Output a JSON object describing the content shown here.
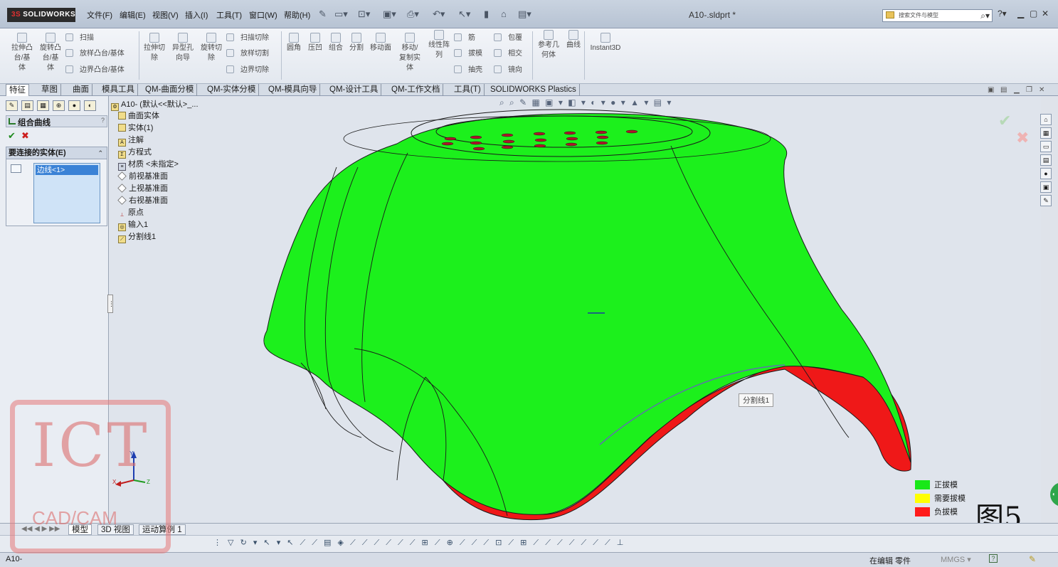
{
  "titlebar": {
    "logo": "SOLIDWORKS",
    "menus": [
      "文件(F)",
      "编辑(E)",
      "视图(V)",
      "插入(I)",
      "工具(T)",
      "窗口(W)",
      "帮助(H)"
    ],
    "document_title": "A10-.sldprt *",
    "search_placeholder": "搜索文件与模型"
  },
  "ribbon": {
    "big_buttons": [
      {
        "label": "拉伸凸\n台/基\n体"
      },
      {
        "label": "旋转凸\n台/基\n体"
      },
      {
        "label": "拉伸切\n除"
      },
      {
        "label": "异型孔\n向导"
      },
      {
        "label": "旋转切\n除"
      },
      {
        "label": "圆角"
      },
      {
        "label": "压凹"
      },
      {
        "label": "组合"
      },
      {
        "label": "分割"
      },
      {
        "label": "移动面"
      },
      {
        "label": "移动/\n复制实\n体"
      },
      {
        "label": "线性阵\n列"
      },
      {
        "label": "参考几\n何体"
      },
      {
        "label": "曲线"
      },
      {
        "label": "Instant3D"
      }
    ],
    "small_buttons": [
      "扫描",
      "放样凸台/基体",
      "边界凸台/基体",
      "扫描切除",
      "放样切割",
      "边界切除",
      "筋",
      "拔模",
      "抽壳",
      "包覆",
      "相交",
      "镜向"
    ]
  },
  "tabs": [
    "特征",
    "草图",
    "曲面",
    "模具工具",
    "QM-曲面分模",
    "QM-实体分模",
    "QM-模具向导",
    "QM-设计工具",
    "QM-工作文档",
    "工具(T)",
    "SOLIDWORKS Plastics"
  ],
  "property_manager": {
    "title": "组合曲线",
    "help": "?",
    "group_title": "要连接的实体(E)",
    "selection": "边线<1>"
  },
  "feature_tree": {
    "root": "A10-  (默认<<默认>_...",
    "items": [
      "曲面实体",
      "实体(1)",
      "注解",
      "方程式",
      "材质 <未指定>",
      "前视基准面",
      "上视基准面",
      "右视基准面",
      "原点",
      "输入1",
      "分割线1"
    ]
  },
  "graphics": {
    "callout": "分割线1",
    "legend": [
      {
        "label": "正拔模",
        "color": "#18e818"
      },
      {
        "label": "需要拔模",
        "color": "#ffff00"
      },
      {
        "label": "负拔模",
        "color": "#ff1a1a"
      }
    ],
    "figure_label": "图5",
    "model_colors": {
      "positive": "#1cf01c",
      "negative": "#f01818"
    }
  },
  "bottom_tabs": [
    "模型",
    "3D 视图",
    "运动算例 1"
  ],
  "status": {
    "left": "A10-",
    "mode": "在编辑 零件",
    "units": "MMGS",
    "units_arrow": "▾",
    "help": "?"
  },
  "watermark": {
    "title": "ICT",
    "subtitle": "CAD/CAM"
  }
}
